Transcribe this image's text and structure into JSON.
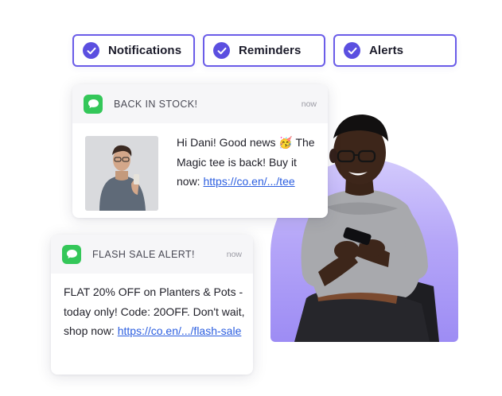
{
  "pills": [
    {
      "label": "Notifications"
    },
    {
      "label": "Reminders"
    },
    {
      "label": "Alerts"
    }
  ],
  "cards": {
    "stock": {
      "title": "BACK IN STOCK!",
      "time": "now",
      "message_line1": "Hi Dani! Good news 🥳 The Magic tee is back! Buy it now: ",
      "link": "https://co.en/.../tee"
    },
    "sale": {
      "title": "FLASH SALE ALERT!",
      "time": "now",
      "message": "FLAT 20% OFF on Planters & Pots - today only! Code: 20OFF. Don't wait, shop now: ",
      "link": "https://co.en/.../flash-sale"
    }
  },
  "colors": {
    "accent": "#5b4fe0",
    "pill_border": "#6a5ce8",
    "app_icon": "#34c759",
    "link": "#2b5ee0",
    "arch_top": "#d3cafc",
    "arch_bottom": "#9d8cf4"
  },
  "icons": {
    "pill": "check-circle-icon",
    "card": "messages-app-icon"
  }
}
